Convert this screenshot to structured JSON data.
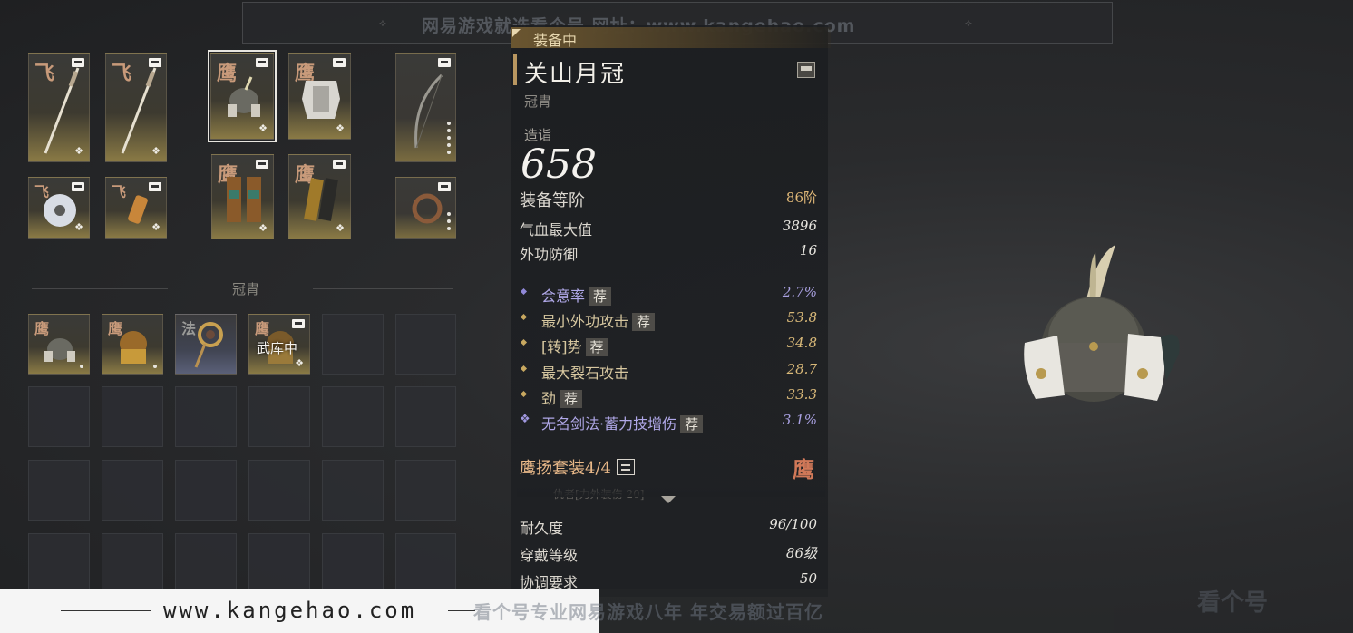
{
  "watermark_top": {
    "text": "网易游戏就选看个号  网址：www.kangehao.com",
    "ornament": "⟡"
  },
  "equipment_slots": {
    "row1": [
      {
        "mark": "飞",
        "name": "spear-1"
      },
      {
        "mark": "飞",
        "name": "spear-2"
      },
      {
        "mark": "鹰",
        "name": "helmet-equipped"
      },
      {
        "mark": "鹰",
        "name": "chest-armor"
      },
      {
        "mark": "",
        "name": "bow"
      }
    ],
    "row2": [
      {
        "mark": "飞",
        "name": "jade-disc"
      },
      {
        "mark": "飞",
        "name": "pendant"
      },
      {
        "mark": "鹰",
        "name": "legguards"
      },
      {
        "mark": "鹰",
        "name": "bracers"
      },
      {
        "mark": "",
        "name": "ring"
      }
    ]
  },
  "inventory": {
    "section_label": "冠胄",
    "items": [
      {
        "mark": "鹰",
        "name": "helmet-1",
        "status": ""
      },
      {
        "mark": "鹰",
        "name": "helmet-2",
        "status": ""
      },
      {
        "mark": "法",
        "name": "hairpin",
        "status": ""
      },
      {
        "mark": "鹰",
        "name": "helmet-armory",
        "status": "武库中"
      }
    ]
  },
  "detail": {
    "equipped_label": "装备中",
    "title": "关山月冠",
    "type": "冠胄",
    "score_label": "造诣",
    "score": "658",
    "grade_label": "装备等阶",
    "grade_value": "86阶",
    "base_stats": [
      {
        "name": "气血最大值",
        "value": "3896"
      },
      {
        "name": "外功防御",
        "value": "16"
      }
    ],
    "sub_stats": [
      {
        "name": "会意率",
        "value": "2.7%",
        "rec": "荐",
        "style": "purple"
      },
      {
        "name": "最小外功攻击",
        "value": "53.8",
        "rec": "荐",
        "style": "gold"
      },
      {
        "name": "[转]势",
        "value": "34.8",
        "rec": "荐",
        "style": "gold"
      },
      {
        "name": "最大裂石攻击",
        "value": "28.7",
        "rec": "",
        "style": "gold"
      },
      {
        "name": "劲",
        "value": "33.3",
        "rec": "荐",
        "style": "gold"
      },
      {
        "name": "无名剑法·蓄力技增伤",
        "value": "3.1%",
        "rec": "荐",
        "style": "star"
      }
    ],
    "set_title": "鹰扬套装4/4",
    "set_mark": "鹰",
    "set_truncated": "仇者[力外装伤  20]",
    "durability_label": "耐久度",
    "durability_value": "96/100",
    "wear_level_label": "穿戴等级",
    "wear_level_value": "86级",
    "coord_label": "协调要求",
    "coord_value": "50"
  },
  "watermark_bottom": {
    "url": "www.kangehao.com",
    "slogan": "看个号专业网易游戏八年  年交易额过百亿",
    "logo": "看个号"
  },
  "colors": {
    "accent_gold": "#e0b878",
    "purple": "#a8a0e0",
    "mark_red": "#d07858"
  }
}
